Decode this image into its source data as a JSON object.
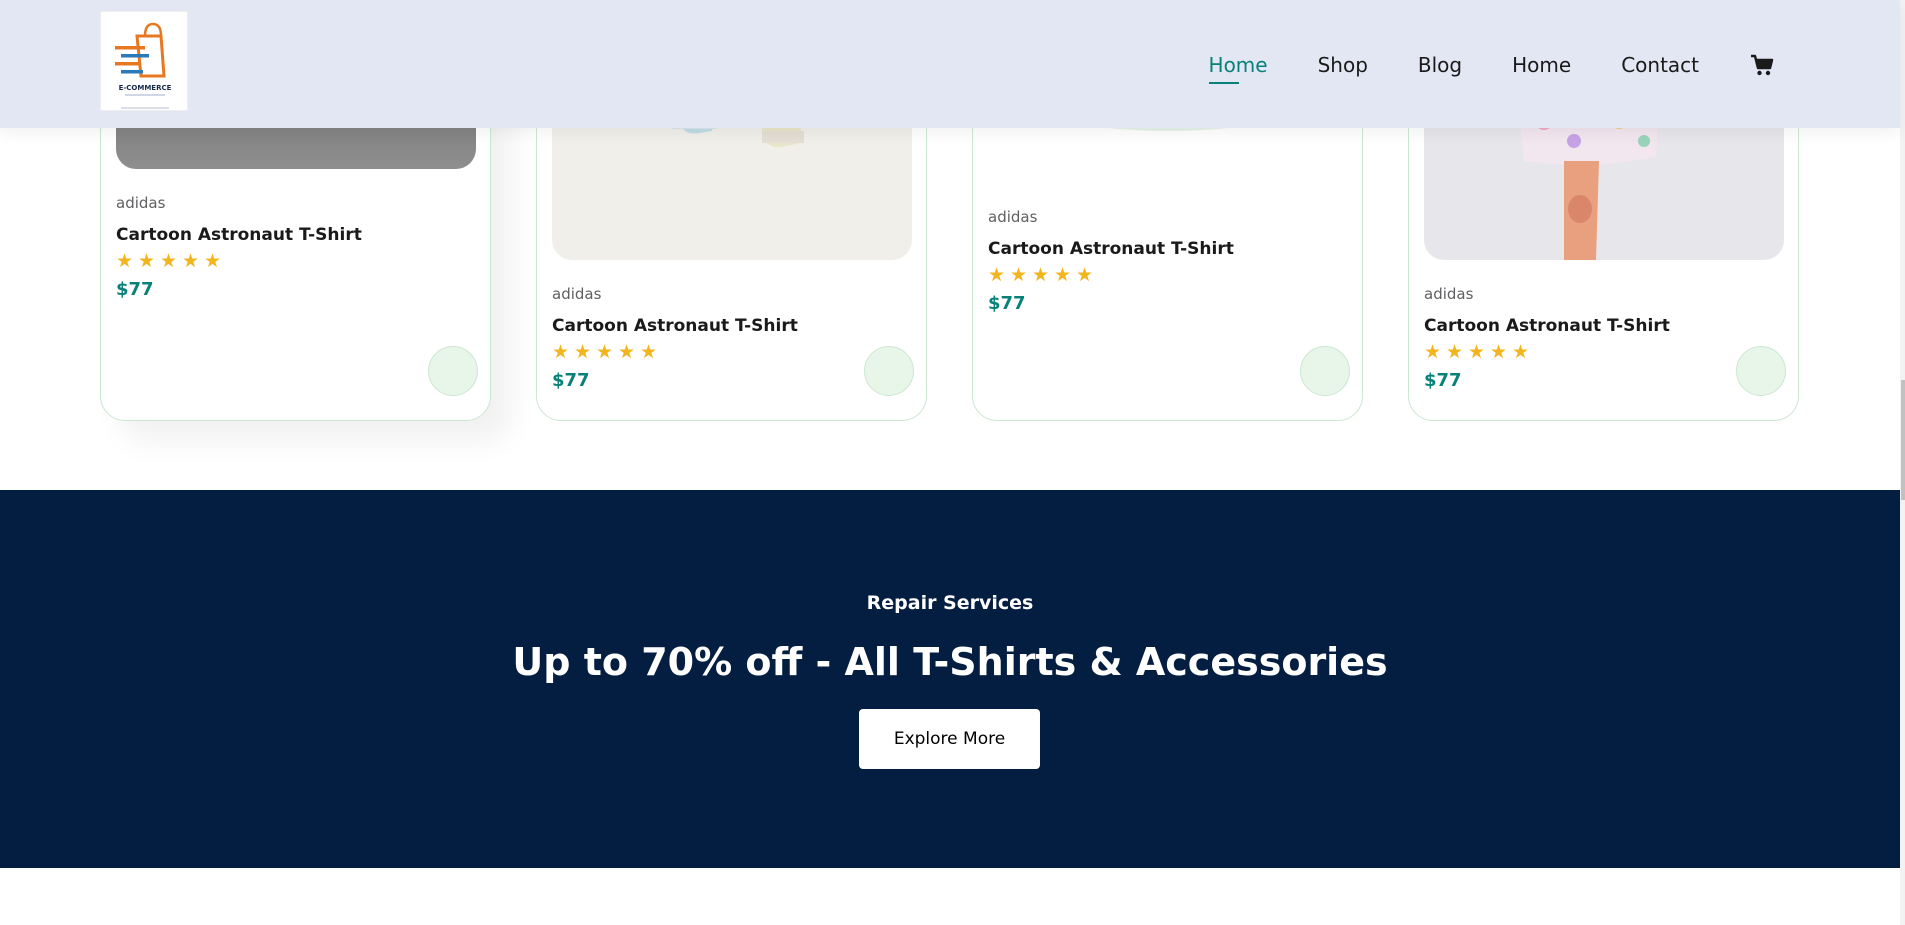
{
  "nav": {
    "logo_text": "E-COMMERCE",
    "items": [
      "Home",
      "Shop",
      "Blog",
      "Home",
      "Contact"
    ],
    "active_index": 0,
    "cart_icon": "cart-icon"
  },
  "products": [
    {
      "brand": "adidas",
      "title": "Cartoon Astronaut T-Shirt",
      "rating": 5,
      "stars": "★★★★★",
      "price": "$77"
    },
    {
      "brand": "adidas",
      "title": "Cartoon Astronaut T-Shirt",
      "rating": 5,
      "stars": "★★★★★",
      "price": "$77"
    },
    {
      "brand": "adidas",
      "title": "Cartoon Astronaut T-Shirt",
      "rating": 5,
      "stars": "★★★★★",
      "price": "$77"
    },
    {
      "brand": "adidas",
      "title": "Cartoon Astronaut T-Shirt",
      "rating": 5,
      "stars": "★★★★★",
      "price": "$77"
    }
  ],
  "banner": {
    "subtitle": "Repair Services",
    "headline": "Up to 70% off - All T-Shirts & Accessories",
    "button": "Explore More"
  },
  "colors": {
    "accent": "#088178",
    "header_bg": "#e3e6f3",
    "banner_bg": "#041e42",
    "star": "#f3b51e"
  }
}
